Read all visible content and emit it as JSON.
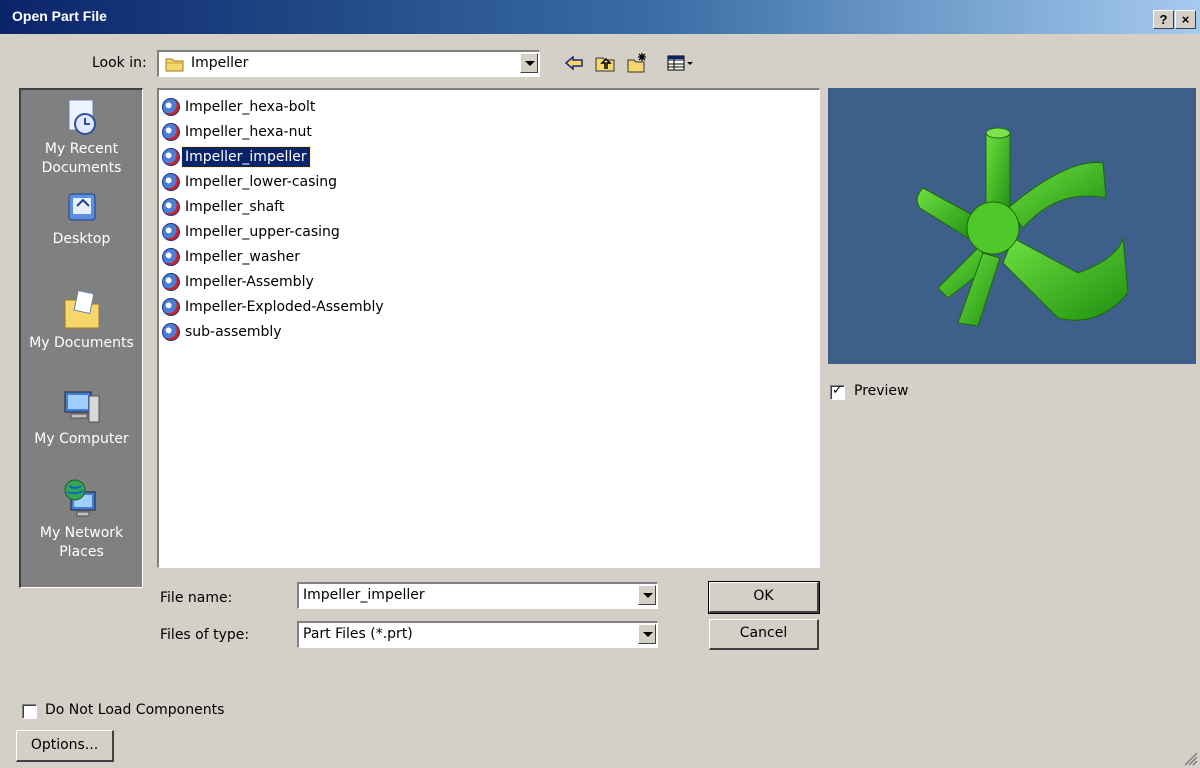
{
  "window": {
    "title": "Open Part File",
    "help_glyph": "?",
    "close_glyph": "×"
  },
  "look_in": {
    "label": "Look in:",
    "value": "Impeller",
    "icon": "folder-icon"
  },
  "toolbar": {
    "icons": [
      "back-arrow-icon",
      "up-one-level-icon",
      "new-folder-icon",
      "view-menu-icon"
    ]
  },
  "places": [
    {
      "label": "My Recent Documents",
      "icon": "recent-documents-icon"
    },
    {
      "label": "Desktop",
      "icon": "desktop-icon"
    },
    {
      "label": "My Documents",
      "icon": "my-documents-icon"
    },
    {
      "label": "My Computer",
      "icon": "my-computer-icon"
    },
    {
      "label": "My Network Places",
      "icon": "network-places-icon"
    }
  ],
  "files": [
    {
      "name": "Impeller_hexa-bolt",
      "selected": false
    },
    {
      "name": "Impeller_hexa-nut",
      "selected": false
    },
    {
      "name": "Impeller_impeller",
      "selected": true
    },
    {
      "name": "Impeller_lower-casing",
      "selected": false
    },
    {
      "name": "Impeller_shaft",
      "selected": false
    },
    {
      "name": "Impeller_upper-casing",
      "selected": false
    },
    {
      "name": "Impeller_washer",
      "selected": false
    },
    {
      "name": "Impeller-Assembly",
      "selected": false
    },
    {
      "name": "Impeller-Exploded-Assembly",
      "selected": false
    },
    {
      "name": "sub-assembly",
      "selected": false
    }
  ],
  "preview": {
    "checkbox_label": "Preview",
    "checked": true,
    "background_color": "#3f5f8b",
    "model_color": "#3cbf1e"
  },
  "file_name": {
    "label": "File name:",
    "value": "Impeller_impeller"
  },
  "file_type": {
    "label": "Files of type:",
    "value": "Part Files (*.prt)"
  },
  "buttons": {
    "ok": "OK",
    "cancel": "Cancel",
    "options": "Options..."
  },
  "do_not_load": {
    "label": "Do Not Load Components",
    "checked": false
  }
}
